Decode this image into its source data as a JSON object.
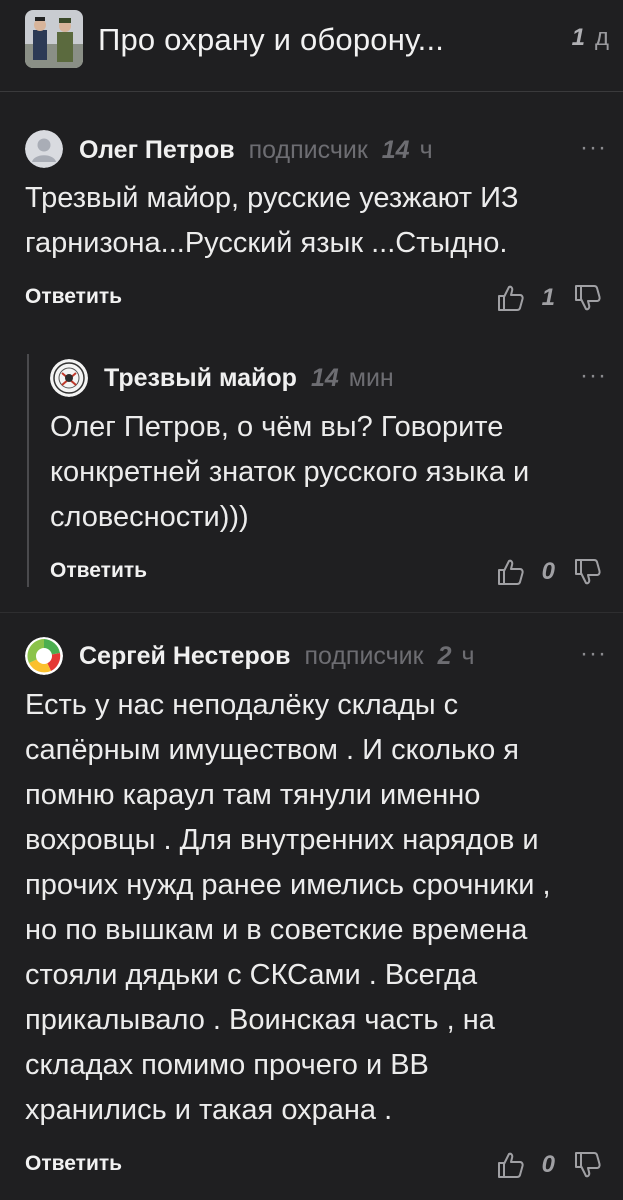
{
  "header": {
    "title": "Про охрану и оборону...",
    "time_num": "1",
    "time_unit": "д"
  },
  "comments": [
    {
      "author": "Олег Петров",
      "badge": "подписчик",
      "time_num": "14",
      "time_unit": "ч",
      "more": "···",
      "lines": [
        "Трезвый майор, русские уезжают ИЗ",
        "гарнизона...Русский язык ...Стыдно."
      ],
      "reply_label": "Ответить",
      "votes": "1"
    },
    {
      "author": "Трезвый майор",
      "badge": "",
      "time_num": "14",
      "time_unit": "мин",
      "more": "···",
      "lines": [
        "Олег Петров, о чём вы? Говорите",
        "конкретней знаток русского языка и",
        "словесности)))"
      ],
      "reply_label": "Ответить",
      "votes": "0"
    },
    {
      "author": "Сергей Нестеров",
      "badge": "подписчик",
      "time_num": "2",
      "time_unit": "ч",
      "more": "···",
      "lines": [
        "Есть у нас неподалёку склады с",
        "сапёрным имуществом . И сколько я",
        "помню караул там тянули именно",
        "вохровцы . Для внутренних нарядов и",
        "прочих нужд ранее имелись срочники ,",
        "но по вышкам и в советские времена",
        "стояли дядьки с СКСами . Всегда",
        "прикалывало . Воинская часть , на",
        "складах помимо прочего и ВВ",
        "хранились и такая охрана ."
      ],
      "reply_label": "Ответить",
      "votes": "0"
    }
  ],
  "colors": {
    "background": "#1f1f21",
    "text": "#ececec",
    "muted": "#6d6d72",
    "divider": "#3a3a3c"
  }
}
